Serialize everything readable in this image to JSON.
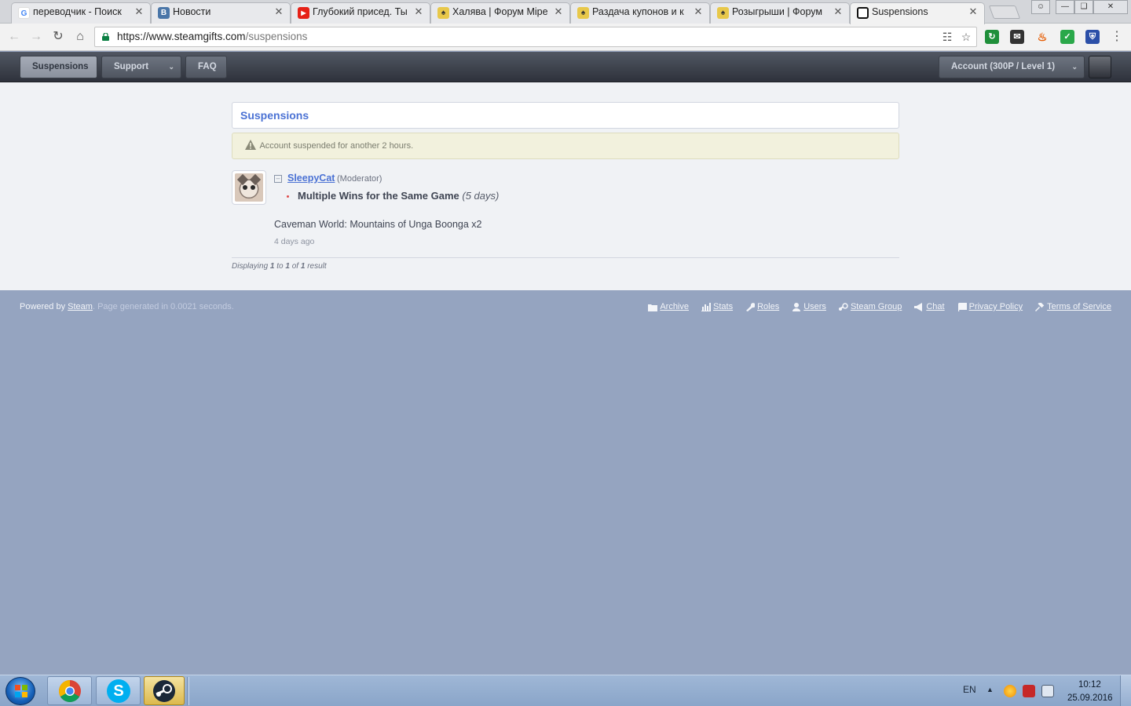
{
  "browser": {
    "tabs": [
      {
        "title": "переводчик - Поиск",
        "icon": "google-icon",
        "icon_color": "#4285f4",
        "icon_glyph": "G"
      },
      {
        "title": "Новости",
        "icon": "vk-icon",
        "icon_color": "#4a76a8",
        "icon_glyph": "В"
      },
      {
        "title": "Глубокий присед. Ты",
        "icon": "youtube-icon",
        "icon_color": "#e62117",
        "icon_glyph": "▶"
      },
      {
        "title": "Халява | Форум Mipe",
        "icon": "forum-icon",
        "icon_color": "#7a6a2a",
        "icon_glyph": "♠"
      },
      {
        "title": "Раздача купонов и к",
        "icon": "forum-icon",
        "icon_color": "#7a6a2a",
        "icon_glyph": "♠"
      },
      {
        "title": "Розыгрыши | Форум",
        "icon": "forum-icon",
        "icon_color": "#7a6a2a",
        "icon_glyph": "♠"
      },
      {
        "title": "Suspensions",
        "icon": "steamgifts-icon",
        "icon_color": "#222222",
        "icon_glyph": "▣"
      }
    ],
    "url_host": "https://www.steamgifts.com",
    "url_path": "/suspensions"
  },
  "site_nav": {
    "suspensions": "Suspensions",
    "support": "Support",
    "faq": "FAQ",
    "account": "Account (300P / Level 1)"
  },
  "main": {
    "title": "Suspensions",
    "notice": "Account suspended for another 2 hours.",
    "entry": {
      "moderator": "SleepyCat",
      "role": "(Moderator)",
      "reason": "Multiple Wins for the Same Game",
      "duration": "(5 days)",
      "game": "Caveman World: Mountains of Unga Boonga x2",
      "time_ago": "4 days ago"
    },
    "pagination": {
      "prefix": "Displaying",
      "from": "1",
      "to_word": "to",
      "to": "1",
      "of_word": "of",
      "total": "1",
      "suffix": "result"
    }
  },
  "footer": {
    "powered_prefix": "Powered by",
    "steam": "Steam",
    "generated": ". Page generated in 0.0021 seconds.",
    "links": [
      {
        "label": "Archive",
        "icon": "folder-icon"
      },
      {
        "label": "Stats",
        "icon": "bar-chart-icon"
      },
      {
        "label": "Roles",
        "icon": "wrench-icon"
      },
      {
        "label": "Users",
        "icon": "user-icon"
      },
      {
        "label": "Steam Group",
        "icon": "steam-icon"
      },
      {
        "label": "Chat",
        "icon": "megaphone-icon"
      },
      {
        "label": "Privacy Policy",
        "icon": "book-icon"
      },
      {
        "label": "Terms of Service",
        "icon": "gavel-icon"
      }
    ]
  },
  "taskbar": {
    "language": "EN",
    "time": "10:12",
    "date": "25.09.2016",
    "apps": [
      "chrome",
      "skype",
      "steam"
    ]
  },
  "colors": {
    "accent": "#4b72d4",
    "notice_bg": "#f2f1dd",
    "footer_bg": "#95a4c0"
  }
}
